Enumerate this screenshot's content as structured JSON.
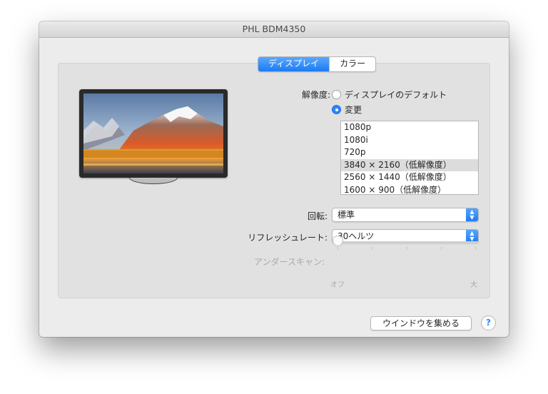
{
  "window": {
    "title": "PHL BDM4350"
  },
  "tabs": [
    {
      "label": "ディスプレイ",
      "active": true
    },
    {
      "label": "カラー",
      "active": false
    }
  ],
  "resolution": {
    "label": "解像度:",
    "options": [
      {
        "label": "ディスプレイのデフォルト",
        "selected": false
      },
      {
        "label": "変更",
        "selected": true
      }
    ],
    "list": [
      "1080p",
      "1080i",
      "720p",
      "3840 × 2160（低解像度）",
      "2560 × 1440（低解像度）",
      "1600 × 900（低解像度）"
    ],
    "selected_index": 3
  },
  "rotation": {
    "label": "回転:",
    "value": "標準"
  },
  "refresh_rate": {
    "label": "リフレッシュレート:",
    "value": "30ヘルツ"
  },
  "underscan": {
    "label": "アンダースキャン:",
    "min_label": "オフ",
    "max_label": "大",
    "value": 0
  },
  "footer": {
    "gather_button": "ウインドウを集める",
    "help": "?"
  },
  "colors": {
    "accent": "#2a87f6",
    "window_bg": "#ececec",
    "panel_bg": "#e1e1e1"
  }
}
